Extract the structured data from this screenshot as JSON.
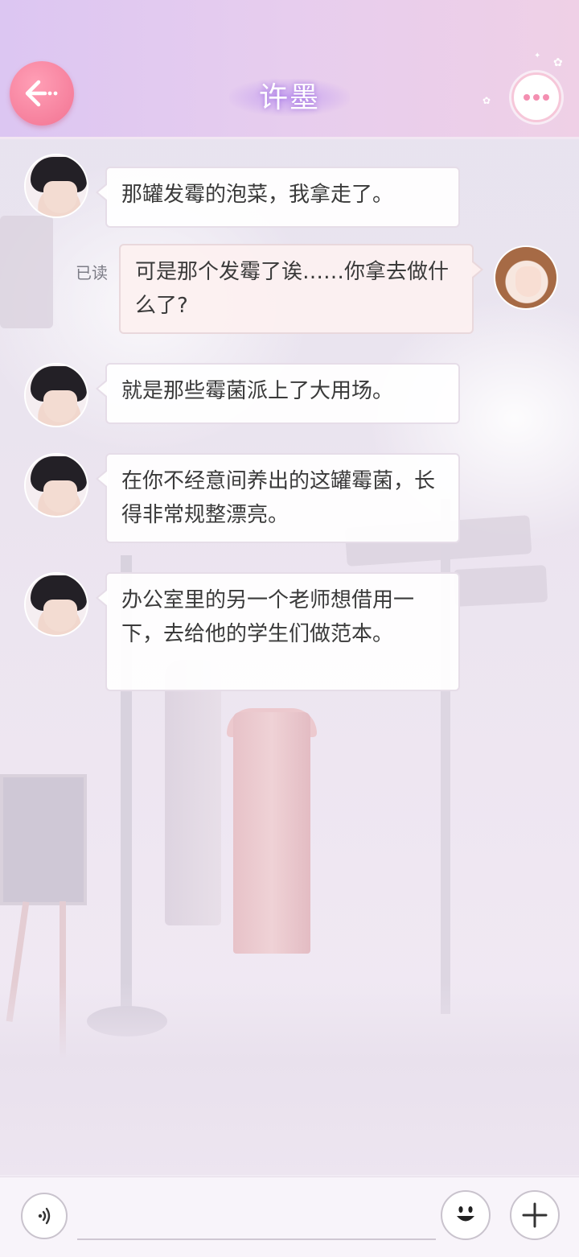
{
  "header": {
    "title": "许墨",
    "back_icon": "back-arrow-icon",
    "more_icon": "more-dots-icon"
  },
  "messages": [
    {
      "side": "left",
      "sender": "许墨",
      "text": "那罐发霉的泡菜，我拿走了。"
    },
    {
      "side": "right",
      "sender": "me",
      "read_label": "已读",
      "text": "可是那个发霉了诶……你拿去做什么了?"
    },
    {
      "side": "left",
      "sender": "许墨",
      "text": "就是那些霉菌派上了大用场。"
    },
    {
      "side": "left",
      "sender": "许墨",
      "text": "在你不经意间养出的这罐霉菌，长得非常规整漂亮。"
    },
    {
      "side": "left",
      "sender": "许墨",
      "text": "办公室里的另一个老师想借用一下，去给他的学生们做范本。"
    }
  ],
  "input_bar": {
    "voice_icon": "voice-icon",
    "input_value": "",
    "emoji_icon": "emoji-icon",
    "plus_icon": "plus-icon"
  },
  "colors": {
    "header_gradient_start": "#dcc6f2",
    "header_gradient_end": "#efd0e6",
    "back_button": "#f27392",
    "more_dots": "#f48fb1"
  }
}
